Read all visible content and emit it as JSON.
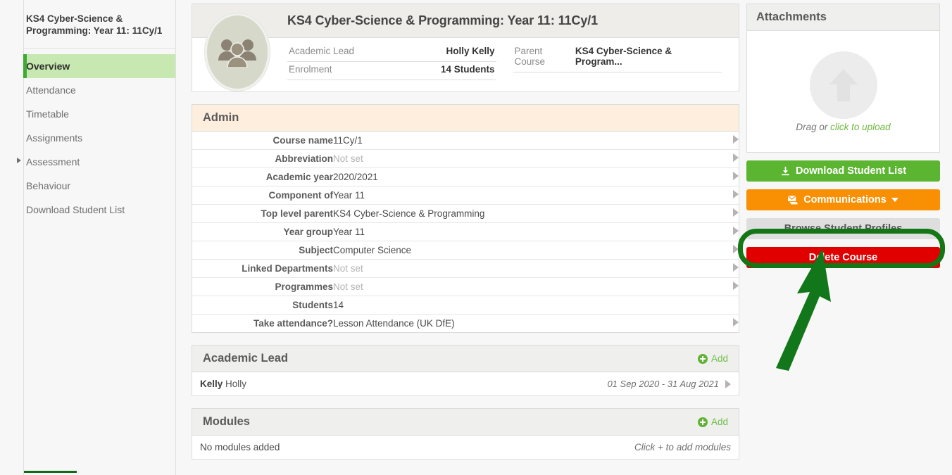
{
  "sidebar": {
    "title": "KS4 Cyber-Science & Programming: Year 11: 11Cy/1",
    "items": [
      {
        "label": "Overview",
        "active": true,
        "expandable": false
      },
      {
        "label": "Attendance",
        "active": false,
        "expandable": false
      },
      {
        "label": "Timetable",
        "active": false,
        "expandable": false
      },
      {
        "label": "Assignments",
        "active": false,
        "expandable": false
      },
      {
        "label": "Assessment",
        "active": false,
        "expandable": true
      },
      {
        "label": "Behaviour",
        "active": false,
        "expandable": false
      },
      {
        "label": "Download Student List",
        "active": false,
        "expandable": false
      }
    ]
  },
  "header": {
    "title": "KS4 Cyber-Science & Programming: Year 11: 11Cy/1",
    "avatar_icon": "group-people-icon",
    "meta_left": [
      {
        "key": "Academic Lead",
        "value": "Holly Kelly"
      },
      {
        "key": "Enrolment",
        "value": "14 Students"
      }
    ],
    "meta_right": [
      {
        "key": "Parent Course",
        "value": "KS4 Cyber-Science & Program..."
      }
    ]
  },
  "admin": {
    "heading": "Admin",
    "rows": [
      {
        "key": "Course name",
        "value": "11Cy/1",
        "unset": false
      },
      {
        "key": "Abbreviation",
        "value": "Not set",
        "unset": true
      },
      {
        "key": "Academic year",
        "value": "2020/2021",
        "unset": false
      },
      {
        "key": "Component of",
        "value": "Year 11",
        "unset": false
      },
      {
        "key": "Top level parent",
        "value": "KS4 Cyber-Science & Programming",
        "unset": false
      },
      {
        "key": "Year group",
        "value": "Year 11",
        "unset": false
      },
      {
        "key": "Subject",
        "value": "Computer Science",
        "unset": false
      },
      {
        "key": "Linked Departments",
        "value": "Not set",
        "unset": true
      },
      {
        "key": "Programmes",
        "value": "Not set",
        "unset": true
      },
      {
        "key": "Students",
        "value": "14",
        "unset": false
      },
      {
        "key": "Take attendance?",
        "value": "Lesson Attendance (UK DfE)",
        "unset": false
      }
    ]
  },
  "academic_lead": {
    "heading": "Academic Lead",
    "add_label": "Add",
    "surname": "Kelly",
    "forename": "Holly",
    "dates": "01 Sep 2020 - 31 Aug 2021"
  },
  "modules": {
    "heading": "Modules",
    "add_label": "Add",
    "empty_text": "No modules added",
    "hint": "Click + to add modules"
  },
  "attachments": {
    "heading": "Attachments",
    "upload_icon": "upload-arrow-icon",
    "drag_text": "Drag or ",
    "upload_link": "click to upload"
  },
  "actions": {
    "download": "Download Student List",
    "download_icon": "download-icon",
    "communications": "Communications",
    "communications_icon": "mail-stack-icon",
    "browse": "Browse Student Profiles",
    "delete": "Delete Course"
  },
  "colors": {
    "accent_green": "#5cb531",
    "orange": "#f99004",
    "danger_red": "#e00000",
    "highlight_ring": "#147615",
    "nav_active_bg": "#c7e8b0",
    "admin_header_bg": "#fdeedd"
  }
}
